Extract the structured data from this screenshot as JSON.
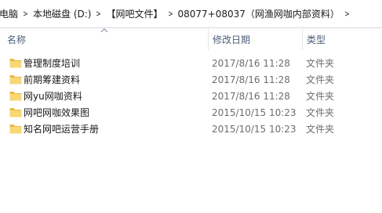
{
  "breadcrumb": [
    {
      "label": "电脑"
    },
    {
      "label": "本地磁盘 (D:)"
    },
    {
      "label": "【网吧文件】"
    },
    {
      "label": "08077+08037（网渔网咖内部资料）"
    }
  ],
  "columns": {
    "name": "名称",
    "date": "修改日期",
    "type": "类型"
  },
  "files": [
    {
      "name": "管理制度培训",
      "date": "2017/8/16 11:28",
      "type": "文件夹",
      "icon": "folder-icon"
    },
    {
      "name": "前期筹建资料",
      "date": "2017/8/16 11:28",
      "type": "文件夹",
      "icon": "folder-icon"
    },
    {
      "name": "网yu网咖资料",
      "date": "2017/8/16 11:28",
      "type": "文件夹",
      "icon": "folder-icon"
    },
    {
      "name": "网吧网咖效果图",
      "date": "2015/10/15 10:23",
      "type": "文件夹",
      "icon": "folder-icon"
    },
    {
      "name": "知名网吧运营手册",
      "date": "2015/10/15 10:23",
      "type": "文件夹",
      "icon": "folder-icon"
    }
  ],
  "colors": {
    "folder_fill": "#f8d775",
    "folder_tab": "#e9b949",
    "header_text": "#4c607a"
  }
}
